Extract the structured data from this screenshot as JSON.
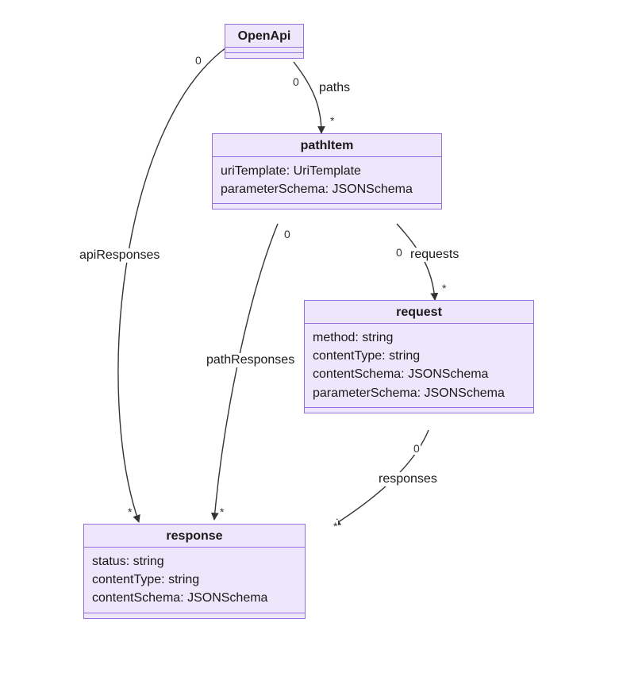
{
  "classes": {
    "OpenApi": {
      "title": "OpenApi",
      "attrs": []
    },
    "pathItem": {
      "title": "pathItem",
      "attrs": [
        "uriTemplate: UriTemplate",
        "parameterSchema: JSONSchema"
      ]
    },
    "request": {
      "title": "request",
      "attrs": [
        "method: string",
        "contentType: string",
        "contentSchema: JSONSchema",
        "parameterSchema: JSONSchema"
      ]
    },
    "response": {
      "title": "response",
      "attrs": [
        "status: string",
        "contentType: string",
        "contentSchema: JSONSchema"
      ]
    }
  },
  "edges": {
    "paths": {
      "label": "paths",
      "card_from": "0",
      "card_to": "*"
    },
    "requests": {
      "label": "requests",
      "card_from": "0",
      "card_to": "*"
    },
    "responses": {
      "label": "responses",
      "card_from": "0",
      "card_to": "*"
    },
    "pathResponses": {
      "label": "pathResponses",
      "card_from": "0",
      "card_to": "*"
    },
    "apiResponses": {
      "label": "apiResponses",
      "card_from": "0",
      "card_to": "*"
    }
  }
}
